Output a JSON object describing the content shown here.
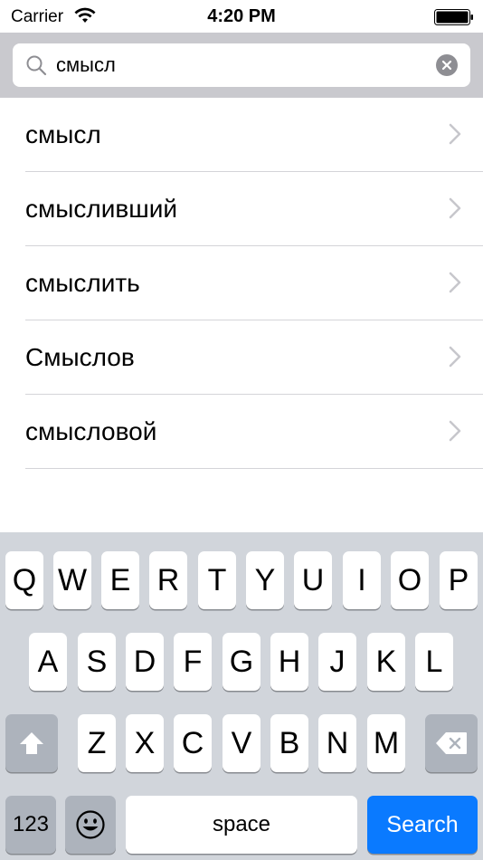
{
  "status_bar": {
    "carrier": "Carrier",
    "time": "4:20 PM"
  },
  "search": {
    "value": "смысл",
    "placeholder": ""
  },
  "results": [
    {
      "label": "смысл"
    },
    {
      "label": "смысливший"
    },
    {
      "label": "смыслить"
    },
    {
      "label": "Смыслов"
    },
    {
      "label": "смысловой"
    }
  ],
  "keyboard": {
    "row1": [
      "Q",
      "W",
      "E",
      "R",
      "T",
      "Y",
      "U",
      "I",
      "O",
      "P"
    ],
    "row2": [
      "A",
      "S",
      "D",
      "F",
      "G",
      "H",
      "J",
      "K",
      "L"
    ],
    "row3": [
      "Z",
      "X",
      "C",
      "V",
      "B",
      "N",
      "M"
    ],
    "numbers_label": "123",
    "space_label": "space",
    "search_label": "Search"
  },
  "colors": {
    "accent": "#0a7aff",
    "keyboard_bg": "#d1d5db",
    "search_bar_bg": "#c9c9ce"
  }
}
